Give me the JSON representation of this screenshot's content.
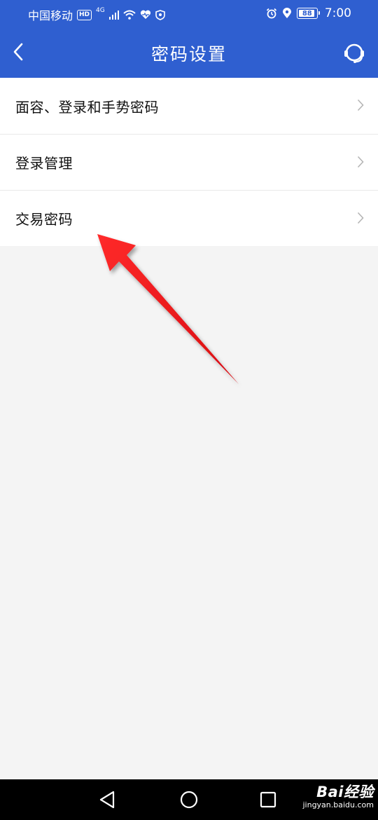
{
  "status_bar": {
    "carrier": "中国移动",
    "hd_badge": "HD",
    "network_type": "4G",
    "battery_level": "88",
    "time": "7:00",
    "icons": [
      "signal-icon",
      "wifi-icon",
      "health-heart-icon",
      "shield-icon",
      "alarm-icon",
      "location-icon",
      "battery-icon"
    ]
  },
  "header": {
    "title": "密码设置",
    "back_icon": "chevron-left-icon",
    "support_icon": "headset-icon",
    "background_color": "#2f5fd0"
  },
  "menu": {
    "items": [
      {
        "label": "面容、登录和手势密码",
        "icon": "chevron-right-icon"
      },
      {
        "label": "登录管理",
        "icon": "chevron-right-icon"
      },
      {
        "label": "交易密码",
        "icon": "chevron-right-icon"
      }
    ]
  },
  "annotation": {
    "type": "red-arrow",
    "color": "#e8141c",
    "target": "交易密码"
  },
  "nav_bar": {
    "icons": [
      "nav-back-icon",
      "nav-home-icon",
      "nav-recent-icon"
    ]
  },
  "watermark": {
    "logo": "Bai经验",
    "url": "jingyan.baidu.com"
  }
}
